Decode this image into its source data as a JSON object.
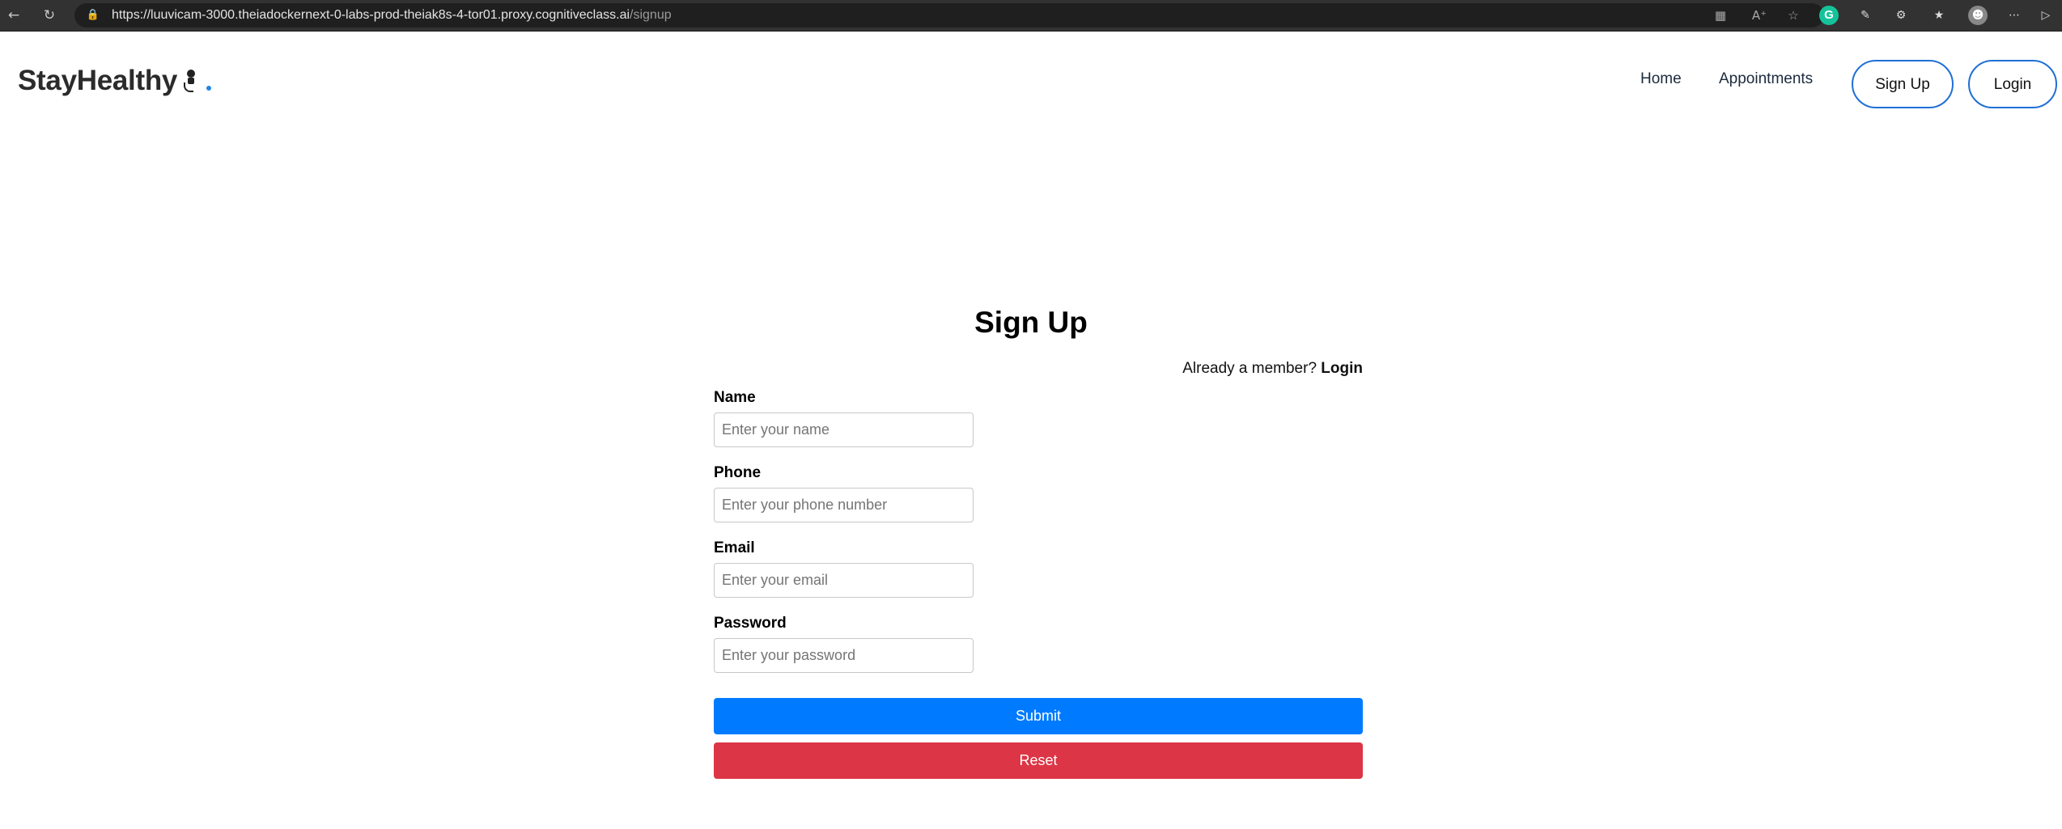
{
  "browser": {
    "url_main": "https://luuvicam-3000.theiadockernext-0-labs-prod-theiak8s-4-tor01.proxy.cognitiveclass.ai",
    "url_path": "/signup",
    "icons": {
      "back": "arrow-left-icon",
      "refresh": "refresh-icon",
      "lock": "lock-icon",
      "apps": "apps-icon",
      "read_aloud": "read-aloud-icon",
      "favorite": "star-icon",
      "grammarly": "grammarly-icon",
      "extension1": "extension-icon",
      "extensions": "puzzle-icon",
      "favorites": "favorites-icon",
      "profile": "profile-avatar",
      "menu": "more-icon",
      "sidebar": "sidebar-icon"
    },
    "grammarly_letter": "G"
  },
  "header": {
    "logo_text": "StayHealthy",
    "nav": {
      "home": "Home",
      "appointments": "Appointments"
    },
    "signup_button": "Sign Up",
    "login_button": "Login",
    "accent_color": "#1f6fd6"
  },
  "form": {
    "title": "Sign Up",
    "member_text": "Already a member?",
    "member_link": "Login",
    "fields": {
      "name": {
        "label": "Name",
        "placeholder": "Enter your name"
      },
      "phone": {
        "label": "Phone",
        "placeholder": "Enter your phone number"
      },
      "email": {
        "label": "Email",
        "placeholder": "Enter your email"
      },
      "password": {
        "label": "Password",
        "placeholder": "Enter your password"
      }
    },
    "submit_label": "Submit",
    "reset_label": "Reset",
    "submit_color": "#007bff",
    "reset_color": "#dc3545"
  }
}
